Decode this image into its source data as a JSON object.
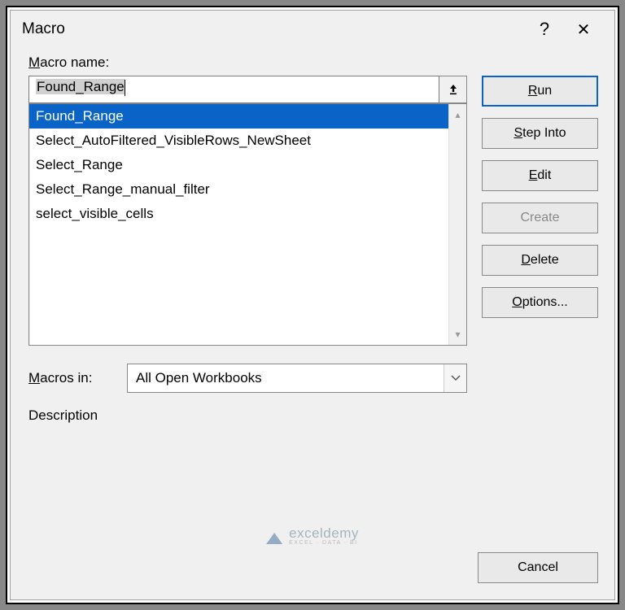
{
  "titlebar": {
    "title": "Macro"
  },
  "labels": {
    "macro_name_prefix": "M",
    "macro_name_rest": "acro name:",
    "macros_in_prefix": "M",
    "macros_in_rest": "acros in:",
    "description": "Description"
  },
  "macro_name_value": "Found_Range",
  "macro_list": {
    "items": [
      "Found_Range",
      "Select_AutoFiltered_VisibleRows_NewSheet",
      "Select_Range",
      "Select_Range_manual_filter",
      "select_visible_cells"
    ],
    "selected_index": 0
  },
  "buttons": {
    "run_u": "R",
    "run_rest": "un",
    "step_u": "S",
    "step_rest": "tep Into",
    "edit_u": "E",
    "edit_rest": "dit",
    "create": "Create",
    "delete_u": "D",
    "delete_rest": "elete",
    "options_u": "O",
    "options_rest": "ptions...",
    "cancel": "Cancel"
  },
  "dropdown": {
    "selected": "All Open Workbooks"
  },
  "watermark": {
    "main": "exceldemy",
    "sub": "EXCEL · DATA · BI"
  }
}
